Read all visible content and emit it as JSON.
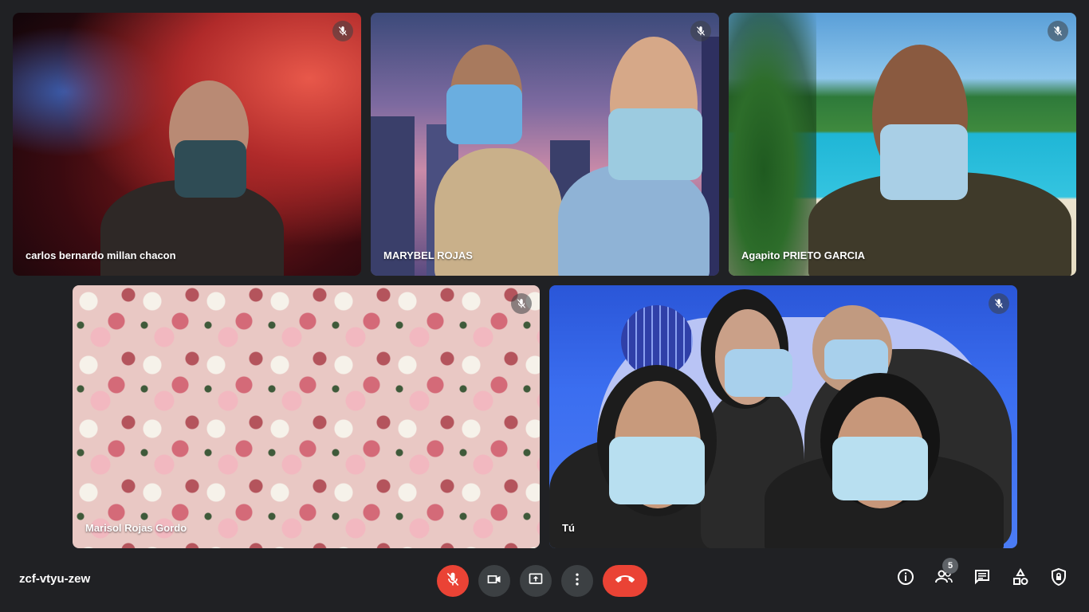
{
  "participants": [
    {
      "name": "carlos bernardo millan chacon",
      "muted": true,
      "background": "nebula"
    },
    {
      "name": "MARYBEL ROJAS",
      "muted": true,
      "background": "city-dusk"
    },
    {
      "name": "Agapito PRIETO GARCIA",
      "muted": true,
      "background": "beach"
    },
    {
      "name": "Marisol Rojas Gordo",
      "muted": true,
      "background": "flower-wall"
    },
    {
      "name": "Tú",
      "muted": true,
      "background": "disco"
    }
  ],
  "meeting": {
    "code": "zcf-vtyu-zew"
  },
  "controls": {
    "mic": {
      "icon": "mic-off-icon",
      "state": "off",
      "color": "#ea4335"
    },
    "camera": {
      "icon": "videocam-icon"
    },
    "present": {
      "icon": "present-screen-icon"
    },
    "more": {
      "icon": "more-vert-icon"
    },
    "end_call": {
      "icon": "call-end-icon",
      "color": "#ea4335"
    }
  },
  "side_controls": {
    "info": {
      "icon": "info-icon"
    },
    "people": {
      "icon": "people-icon",
      "count": "5"
    },
    "chat": {
      "icon": "chat-icon"
    },
    "activities": {
      "icon": "activities-icon"
    },
    "host_controls": {
      "icon": "shield-lock-icon"
    }
  },
  "colors": {
    "background": "#202124",
    "button": "#3c4043",
    "danger": "#ea4335"
  }
}
